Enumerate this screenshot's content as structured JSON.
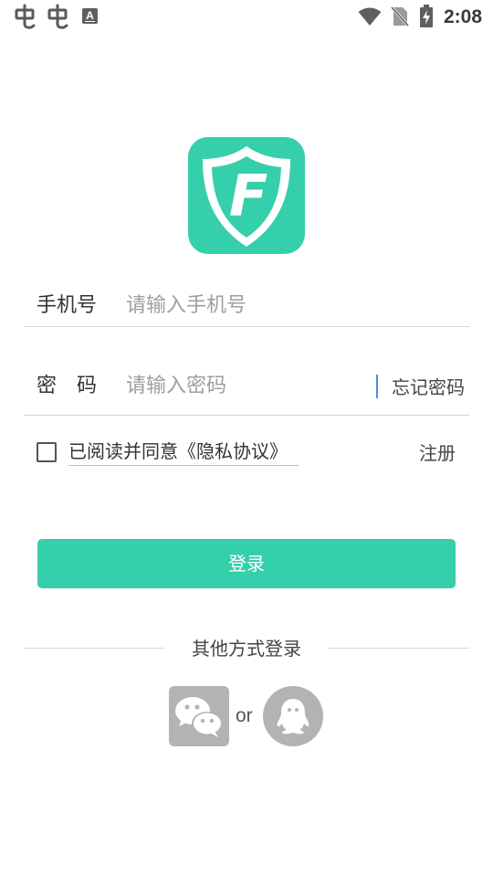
{
  "status_bar": {
    "time": "2:08",
    "left_icons": [
      "bug-icon",
      "bug-icon",
      "a-notification-icon"
    ],
    "right_icons": [
      "wifi-icon",
      "no-sim-icon",
      "battery-charging-icon"
    ]
  },
  "logo": {
    "letter": "F",
    "color": "#36cfab",
    "icon": "shield-f-icon"
  },
  "form": {
    "phone": {
      "label": "手机号",
      "placeholder": "请输入手机号",
      "value": ""
    },
    "password": {
      "label": "密　码",
      "placeholder": "请输入密码",
      "value": ""
    },
    "forgot_label": "忘记密码",
    "agreement_label": "已阅读并同意《隐私协议》",
    "agreement_checked": false,
    "register_label": "注册"
  },
  "login_button": {
    "label": "登录",
    "color": "#36cfab"
  },
  "other_login": {
    "label": "其他方式登录",
    "separator": "or",
    "methods": [
      {
        "name": "wechat",
        "icon": "wechat-icon"
      },
      {
        "name": "qq",
        "icon": "qq-penguin-icon"
      }
    ]
  }
}
